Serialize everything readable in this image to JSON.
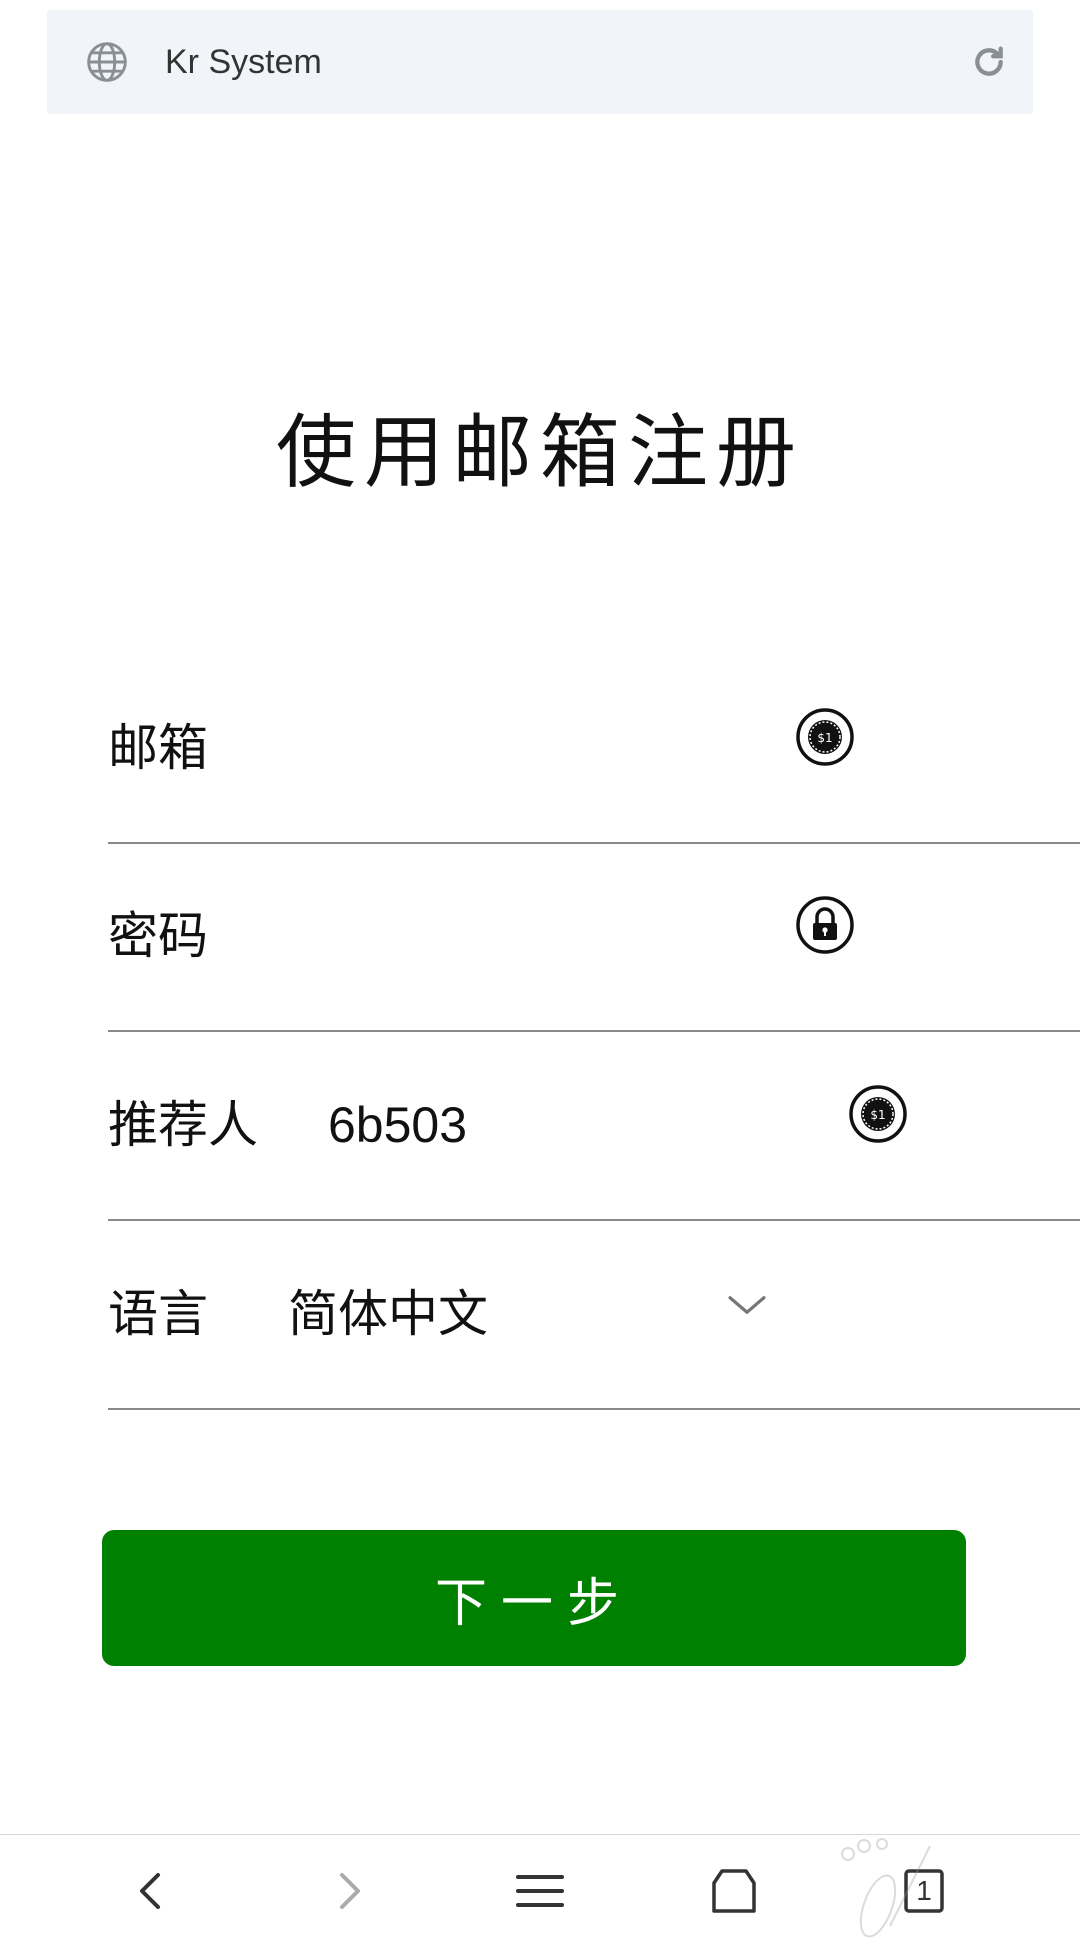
{
  "browser": {
    "page_title": "Kr System",
    "icons": {
      "site": "globe-icon",
      "reload": "reload-icon"
    }
  },
  "form": {
    "heading": "使用邮箱注册",
    "email": {
      "label": "邮箱",
      "value": "",
      "icon": "coin-icon"
    },
    "password": {
      "label": "密码",
      "value": "",
      "icon": "lock-icon"
    },
    "referrer": {
      "label": "推荐人",
      "value": "6b503",
      "icon": "coin-icon"
    },
    "language": {
      "label": "语言",
      "selected": "简体中文",
      "icon": "chevron-down-icon"
    },
    "next_button": "下一步"
  },
  "bottom_nav": {
    "tab_count": "1",
    "items": [
      "back-icon",
      "forward-icon",
      "menu-icon",
      "home-icon",
      "tabs-icon"
    ]
  },
  "colors": {
    "primary_button": "#008000",
    "urlbar_bg": "#f1f4f8",
    "divider": "#8a8a8a"
  }
}
